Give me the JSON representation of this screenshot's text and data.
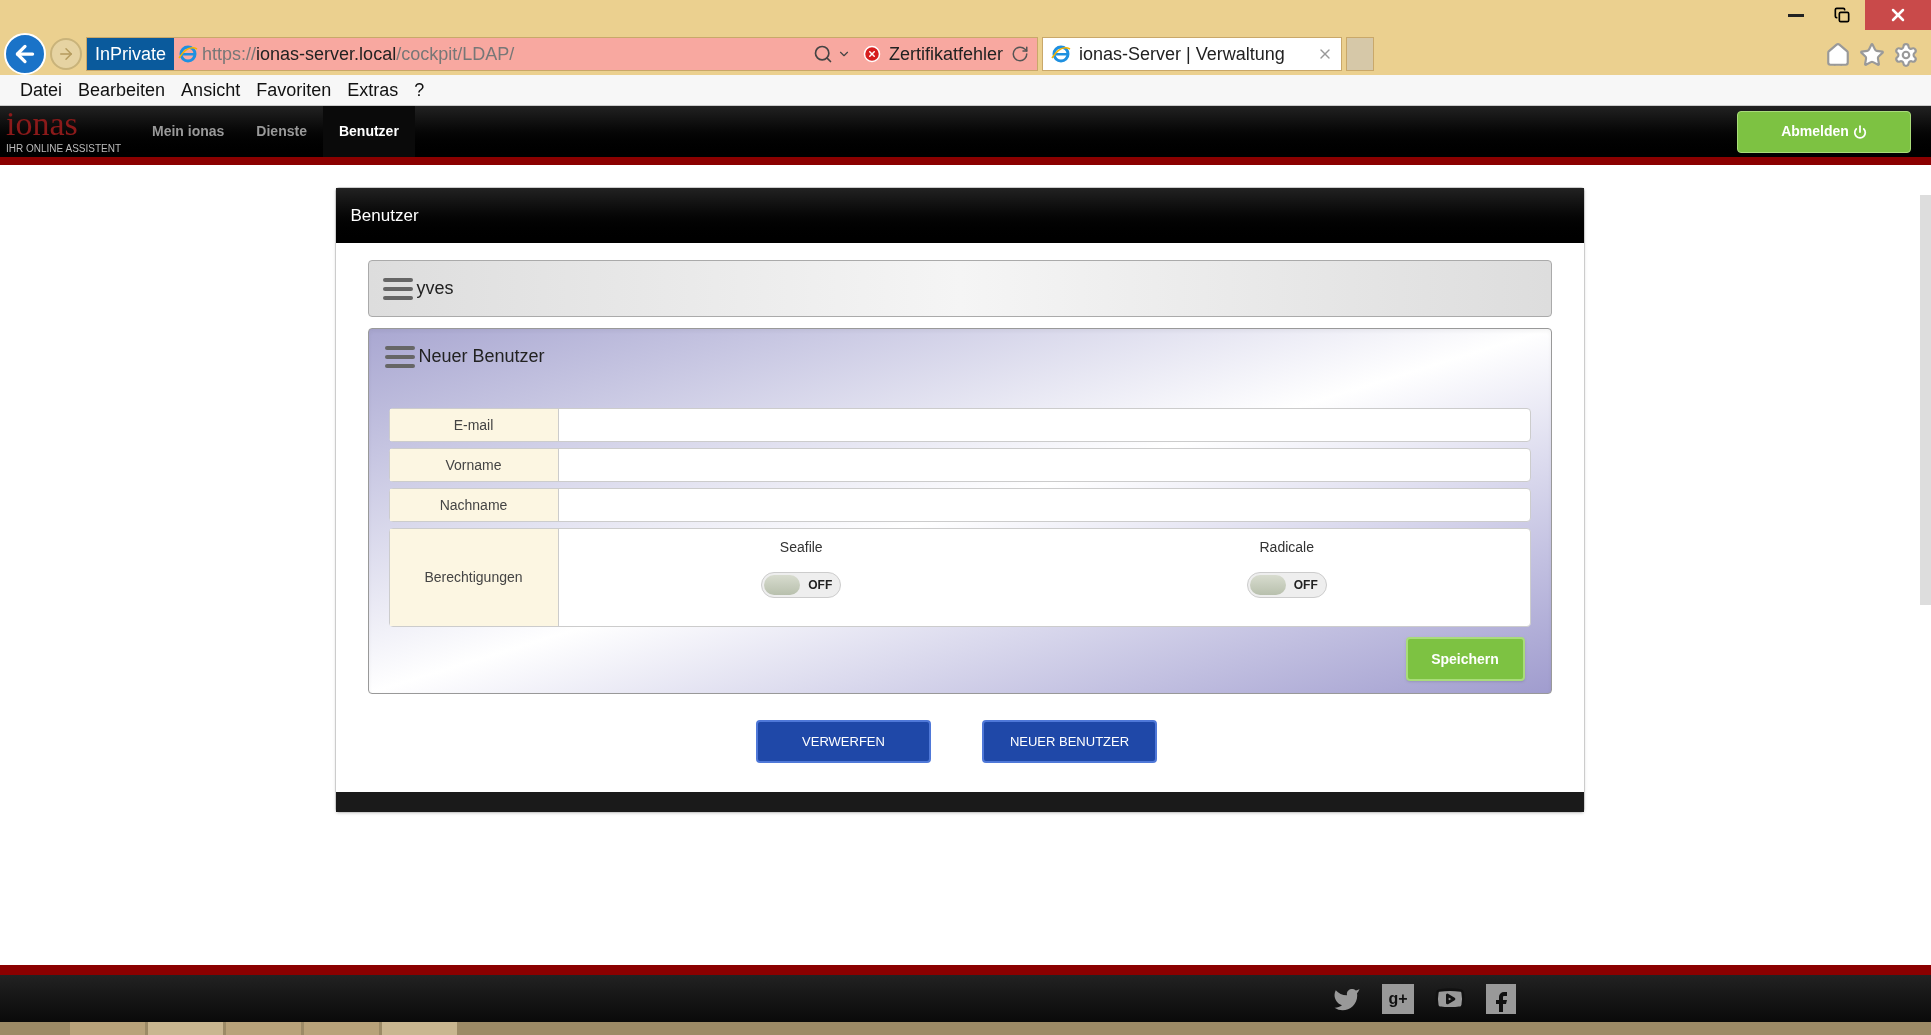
{
  "browser": {
    "private_label": "InPrivate",
    "url_scheme": "https://",
    "url_host": "ionas-server.local",
    "url_path": "/cockpit/LDAP/",
    "cert_error": "Zertifikatfehler",
    "tab_title": "ionas-Server | Verwaltung"
  },
  "menu": [
    "Datei",
    "Bearbeiten",
    "Ansicht",
    "Favoriten",
    "Extras",
    "?"
  ],
  "app": {
    "logo": "ionas",
    "logo_tagline": "IHR ONLINE ASSISTENT",
    "nav": [
      {
        "label": "Mein ionas",
        "selected": false
      },
      {
        "label": "Dienste",
        "selected": false
      },
      {
        "label": "Benutzer",
        "selected": true
      }
    ],
    "logout": "Abmelden"
  },
  "card": {
    "title": "Benutzer",
    "accordions": [
      {
        "title": "yves",
        "expanded": false
      },
      {
        "title": "Neuer Benutzer",
        "expanded": true
      }
    ],
    "fields": [
      {
        "label": "E-mail"
      },
      {
        "label": "Vorname"
      },
      {
        "label": "Nachname"
      }
    ],
    "permissions": {
      "label": "Berechtigungen",
      "toggles": [
        {
          "name": "Seafile",
          "on": false,
          "state_label": "OFF"
        },
        {
          "name": "Radicale",
          "on": false,
          "state_label": "OFF"
        }
      ]
    },
    "save": "Speichern",
    "buttons": [
      "VERWERFEN",
      "NEUER BENUTZER"
    ]
  },
  "footer": {
    "google_plus_glyph": "g+"
  }
}
